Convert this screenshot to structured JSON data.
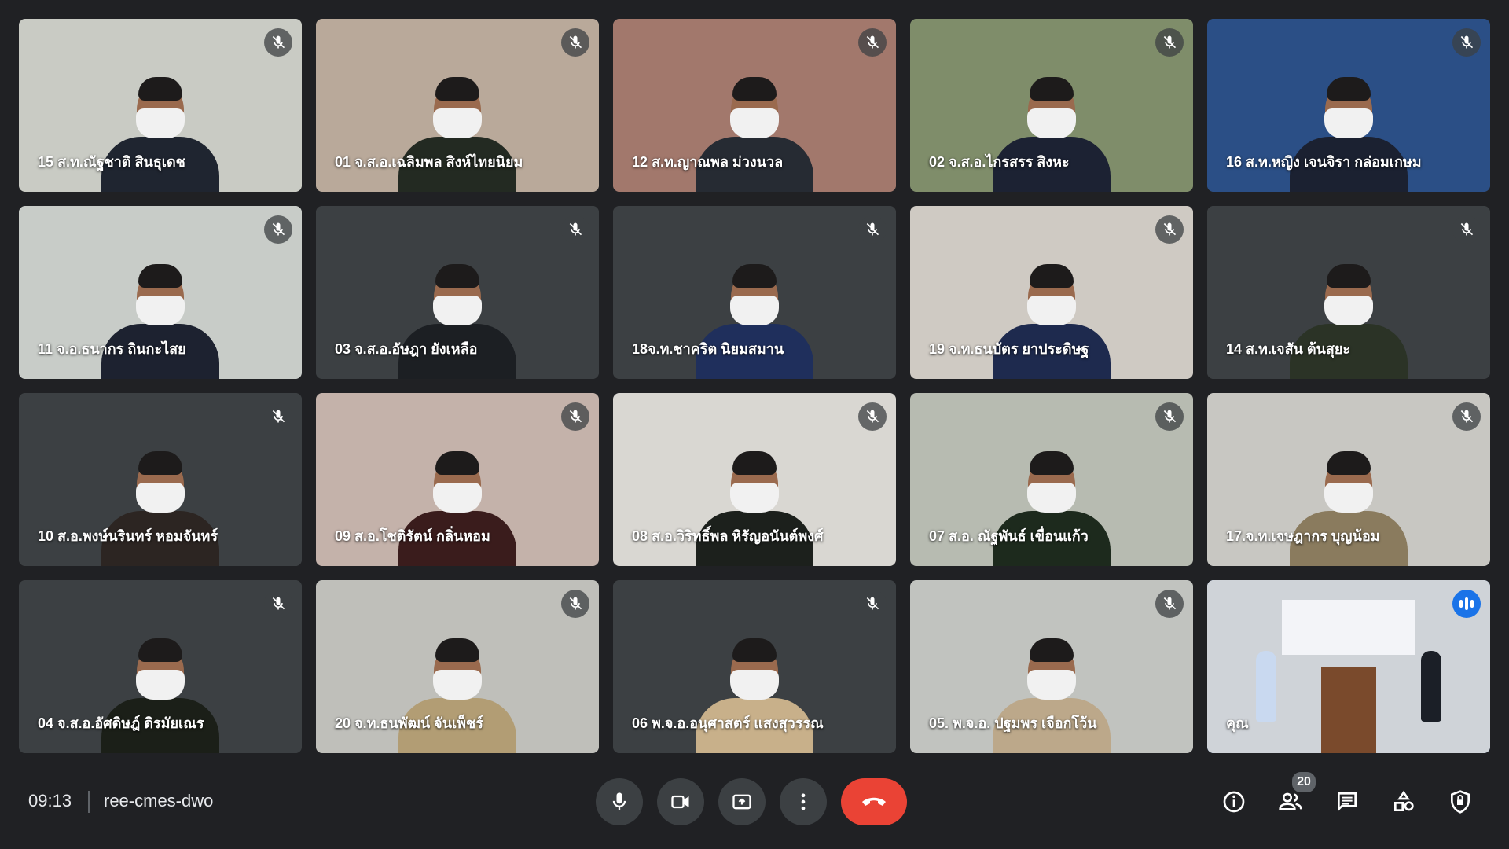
{
  "meeting": {
    "time": "09:13",
    "code": "ree-cmes-dwo"
  },
  "participants": [
    {
      "name": "15 ส.ท.ณัฐชาติ สินธุเดช",
      "muted": true,
      "bg": "#c9cbc4",
      "uniform": "#1f2530"
    },
    {
      "name": "01 จ.ส.อ.เฉลิมพล สิงห์ไทยนิยม",
      "muted": true,
      "bg": "#b9a99a",
      "uniform": "#232a22"
    },
    {
      "name": "12 ส.ท.ญาณพล ม่วงนวล",
      "muted": true,
      "bg": "#a2786c",
      "uniform": "#262b33"
    },
    {
      "name": "02 จ.ส.อ.ไกรสรร สิงหะ",
      "muted": true,
      "bg": "#7f8d6a",
      "uniform": "#1c2233"
    },
    {
      "name": "16 ส.ท.หญิง เจนจิรา กล่อมเกษม",
      "muted": true,
      "bg": "#2b4f86",
      "uniform": "#1b2131"
    },
    {
      "name": "11 จ.อ.ธนากร ถินกะไสย",
      "muted": true,
      "bg": "#c8ccc8",
      "uniform": "#1d2230"
    },
    {
      "name": "03 จ.ส.อ.อัษฎา ยังเหลือ",
      "muted": true,
      "bg": "#3c4043",
      "uniform": "#1c1f23"
    },
    {
      "name": "18จ.ท.ชาคริต นิยมสมาน",
      "muted": true,
      "bg": "#3c4043",
      "uniform": "#1f2f5c"
    },
    {
      "name": "19 จ.ท.ธนบัตร ยาประดิษฐ",
      "muted": true,
      "bg": "#cfcac3",
      "uniform": "#1e2a4e"
    },
    {
      "name": "14 ส.ท.เจสัน ต้นสุยะ",
      "muted": true,
      "bg": "#3c4043",
      "uniform": "#2b3326"
    },
    {
      "name": "10 ส.อ.พงษ์นรินทร์ หอมจันทร์",
      "muted": true,
      "bg": "#3c4043",
      "uniform": "#2c2522"
    },
    {
      "name": "09 ส.อ.โชติรัตน์ กลิ่นหอม",
      "muted": true,
      "bg": "#c4b2aa",
      "uniform": "#3a1c1c"
    },
    {
      "name": "08 ส.อ.วิริทธิ์พล หิรัญอนันต์พงศ์",
      "muted": true,
      "bg": "#d9d7d2",
      "uniform": "#1c201c"
    },
    {
      "name": "07 ส.อ. ณัฐพันธ์ เขื่อนแก้ว",
      "muted": true,
      "bg": "#b7bbb1",
      "uniform": "#1d2a1d"
    },
    {
      "name": "17.จ.ท.เจษฎากร บุญน้อม",
      "muted": true,
      "bg": "#c8c7c2",
      "uniform": "#8a7b5e"
    },
    {
      "name": "04 จ.ส.อ.อัศดิษฎ์ ดิรมัยเณร",
      "muted": true,
      "bg": "#3c4043",
      "uniform": "#1b1f18"
    },
    {
      "name": "20 จ.ท.ธนพัฒน์ จันเพ็ชร์",
      "muted": true,
      "bg": "#bfbfba",
      "uniform": "#b29d74"
    },
    {
      "name": "06 พ.จ.อ.อนุศาสตร์ แสงสุวรรณ",
      "muted": true,
      "bg": "#3c4043",
      "uniform": "#c8b08a"
    },
    {
      "name": "05. พ.จ.อ. ปฐมพร เจือกโว้น",
      "muted": true,
      "bg": "#c1c3bf",
      "uniform": "#bca88a"
    },
    {
      "name": "คุณ",
      "muted": false,
      "speaking": true,
      "bg": "#cfd3d8",
      "uniform": "#7a4a2c"
    }
  ],
  "participant_count": "20",
  "controls": {
    "mic": "microphone-icon",
    "camera": "camera-icon",
    "present": "present-screen-icon",
    "more": "more-options-icon",
    "leave": "end-call-icon"
  },
  "right_icons": [
    "info-icon",
    "people-icon",
    "chat-icon",
    "activities-icon",
    "host-controls-icon"
  ],
  "colors": {
    "background": "#202124",
    "tile": "#3c4043",
    "end_call": "#ea4335",
    "speaking_border": "#8ab4f8",
    "speaking_badge": "#1a73e8"
  }
}
